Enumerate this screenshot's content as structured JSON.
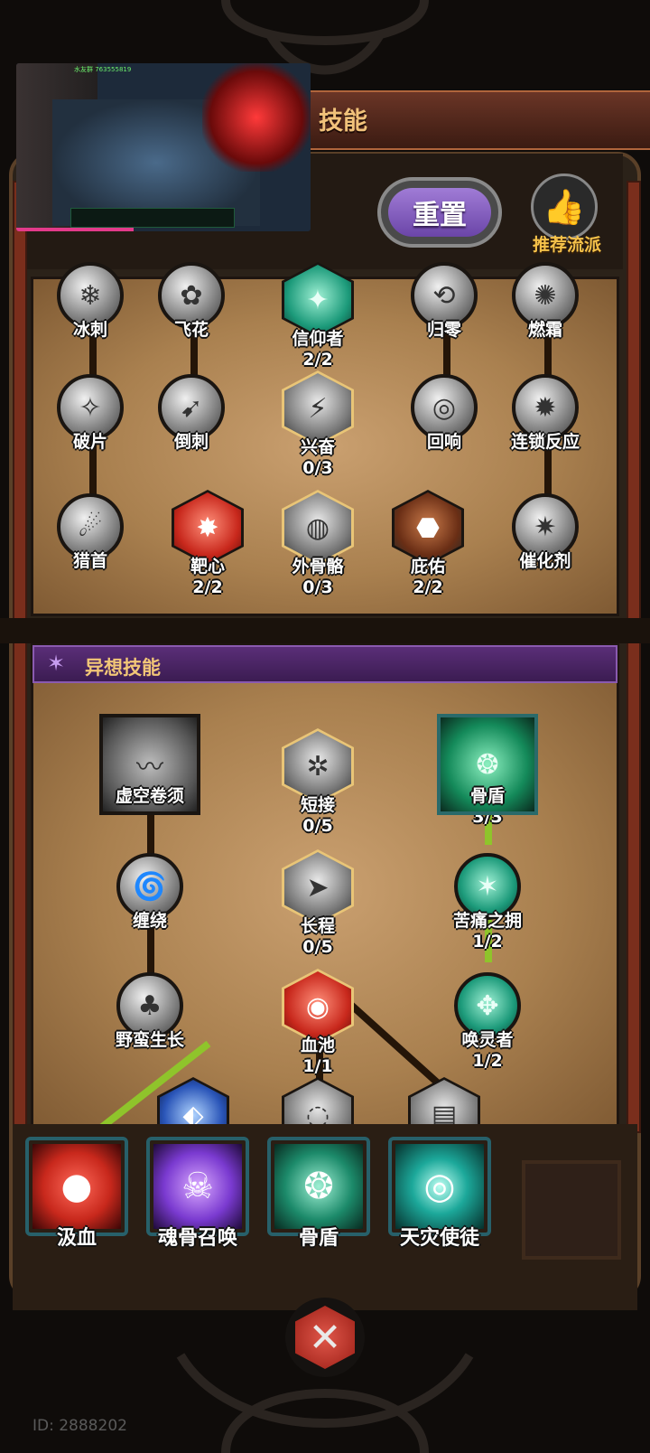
{
  "header": {
    "title": "技能"
  },
  "controls": {
    "reset_label": "重置",
    "recommend_label": "推荐流派"
  },
  "upper_tree": [
    {
      "name": "冰刺"
    },
    {
      "name": "飞花"
    },
    {
      "name": "信仰者",
      "level": "2/2"
    },
    {
      "name": "归零"
    },
    {
      "name": "燃霜"
    },
    {
      "name": "破片"
    },
    {
      "name": "倒刺"
    },
    {
      "name": "兴奋",
      "level": "0/3"
    },
    {
      "name": "回响"
    },
    {
      "name": "连锁反应"
    },
    {
      "name": "猎首"
    },
    {
      "name": "靶心",
      "level": "2/2"
    },
    {
      "name": "外骨骼",
      "level": "0/3"
    },
    {
      "name": "庇佑",
      "level": "2/2"
    },
    {
      "name": "催化剂"
    }
  ],
  "section": {
    "title": "异想技能"
  },
  "lower_tree": [
    {
      "name": "虚空卷须"
    },
    {
      "name": "短接",
      "level": "0/5"
    },
    {
      "name": "骨盾",
      "level": "3/3"
    },
    {
      "name": "缠绕"
    },
    {
      "name": "长程",
      "level": "0/5"
    },
    {
      "name": "苦痛之拥",
      "level": "1/2"
    },
    {
      "name": "野蛮生长"
    },
    {
      "name": "血池",
      "level": "1/1"
    },
    {
      "name": "唤灵者",
      "level": "1/2"
    }
  ],
  "equipped": [
    {
      "name": "汲血",
      "color": "#c8281c"
    },
    {
      "name": "魂骨召唤",
      "color": "#7a3ad0"
    },
    {
      "name": "骨盾",
      "color": "#1c8a6a"
    },
    {
      "name": "天灾使徒",
      "color": "#1ca89a"
    }
  ],
  "footer": {
    "id_text": "ID: 2888202"
  },
  "overlay": {
    "stream_text": "水友群 763555819"
  }
}
